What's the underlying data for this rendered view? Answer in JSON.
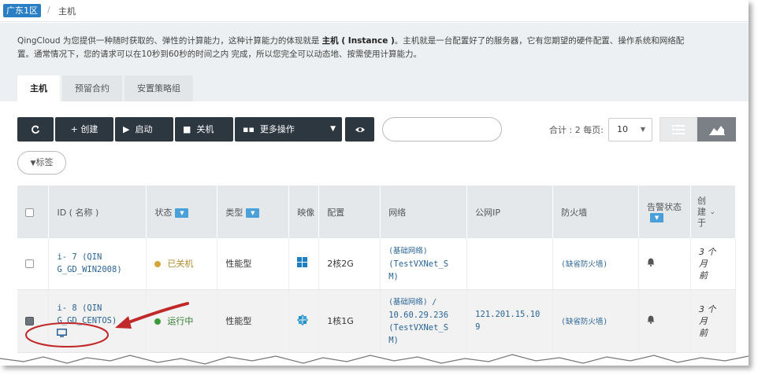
{
  "breadcrumb": {
    "zone": "广东1区",
    "separator": "/",
    "current": "主机"
  },
  "description": {
    "line1_prefix": "QingCloud 为您提供一种随时获取的、弹性的计算能力，这种计算能力的体现就是 ",
    "line1_bold": "主机 ( Instance )",
    "line1_suffix": "。主机就是一台配置好了的服务器，它有您期望的硬件配置、操作系统和网络配",
    "line2": "置。通常情况下，您的请求可以在10秒到60秒的时间之内 完成，所以您完全可以动态地、按需使用计算能力。"
  },
  "tabs": [
    "主机",
    "预留合约",
    "安置策略组"
  ],
  "toolbar": {
    "refresh_icon": "refresh-icon",
    "create": "+  创建",
    "start": "启动",
    "shutdown": "关机",
    "more": "更多操作",
    "search_placeholder": "",
    "total_label": "合计 : 2  每页:",
    "page_size": "10",
    "tag_filter": "标签"
  },
  "table": {
    "headers": {
      "id": "ID ( 名称 )",
      "status": "状态",
      "type": "类型",
      "image": "映像",
      "config": "配置",
      "network": "网络",
      "public_ip": "公网IP",
      "firewall": "防火墙",
      "alarm": "告警状态",
      "created": "创建于"
    },
    "rows": [
      {
        "id": "i-     7 (QIN",
        "name": "G_GD_WIN2008)",
        "status": "已关机",
        "type": "性能型",
        "image_icon": "windows-icon",
        "config": "2核2G",
        "network_line1": "(基础网络)",
        "network_line2": "(TestVXNet_S",
        "network_line3": "M)",
        "public_ip": "",
        "firewall": "(缺省防火墙)",
        "created_line1": "3 个",
        "created_line2": "月",
        "created_line3": "前"
      },
      {
        "id": "i-     8 (QIN",
        "name": "G_GD_CENTOS)",
        "status": "运行中",
        "type": "性能型",
        "image_icon": "centos-icon",
        "config": "1核1G",
        "network_line1": "(基础网络) /",
        "network_line2": "10.60.29.236",
        "network_line3": "(TestVXNet_S",
        "network_line4": "M)",
        "public_ip_line1": "121.201.15.10",
        "public_ip_line2": "9",
        "firewall": "(缺省防火墙)",
        "created_line1": "3 个",
        "created_line2": "月",
        "created_line3": "前"
      }
    ]
  },
  "colors": {
    "toolbar_button": "#2d3740",
    "zone_badge": "#2a7ec4",
    "annotation": "#c0282a",
    "link": "#2a6496"
  }
}
